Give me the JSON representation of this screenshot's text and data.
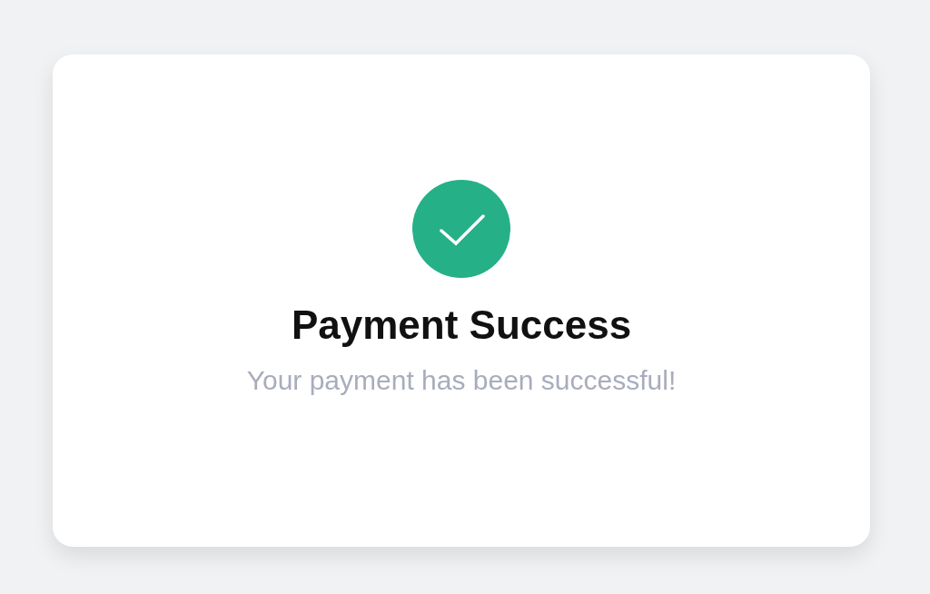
{
  "card": {
    "succeeded": true,
    "title": "Payment Success",
    "message": "Your payment has been successful!"
  }
}
